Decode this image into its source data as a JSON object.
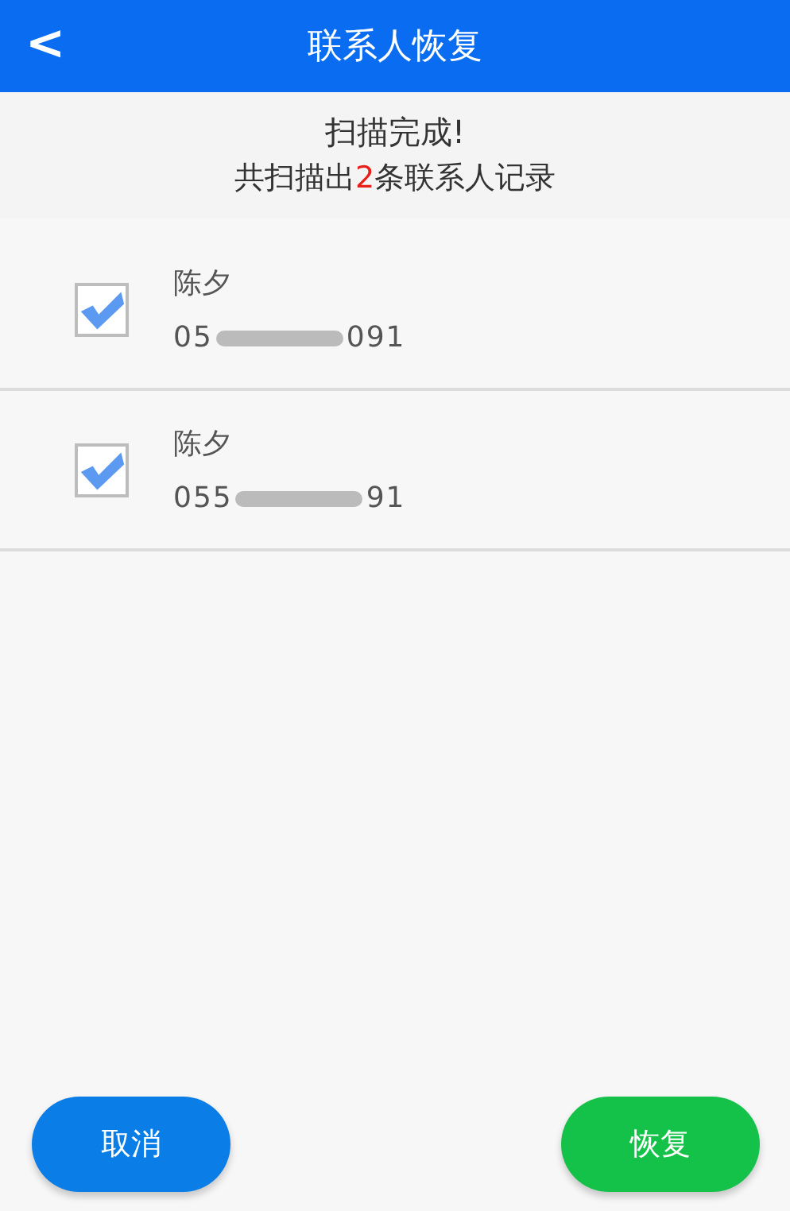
{
  "header": {
    "back_icon": "<",
    "title": "联系人恢复"
  },
  "summary": {
    "title": "扫描完成!",
    "detail": "共扫描出**2**条联系人记录"
  },
  "contacts": [
    {
      "name": "陈夕",
      "phone_start": "05",
      "phone_end": "091",
      "checked": true
    },
    {
      "name": "陈夕",
      "phone_start": "055",
      "phone_end": "91",
      "checked": true
    }
  ],
  "buttons": [
    {
      "label": "取消",
      "kind": "cancel"
    },
    {
      "label": "恢复",
      "kind": "confirm"
    }
  ]
}
